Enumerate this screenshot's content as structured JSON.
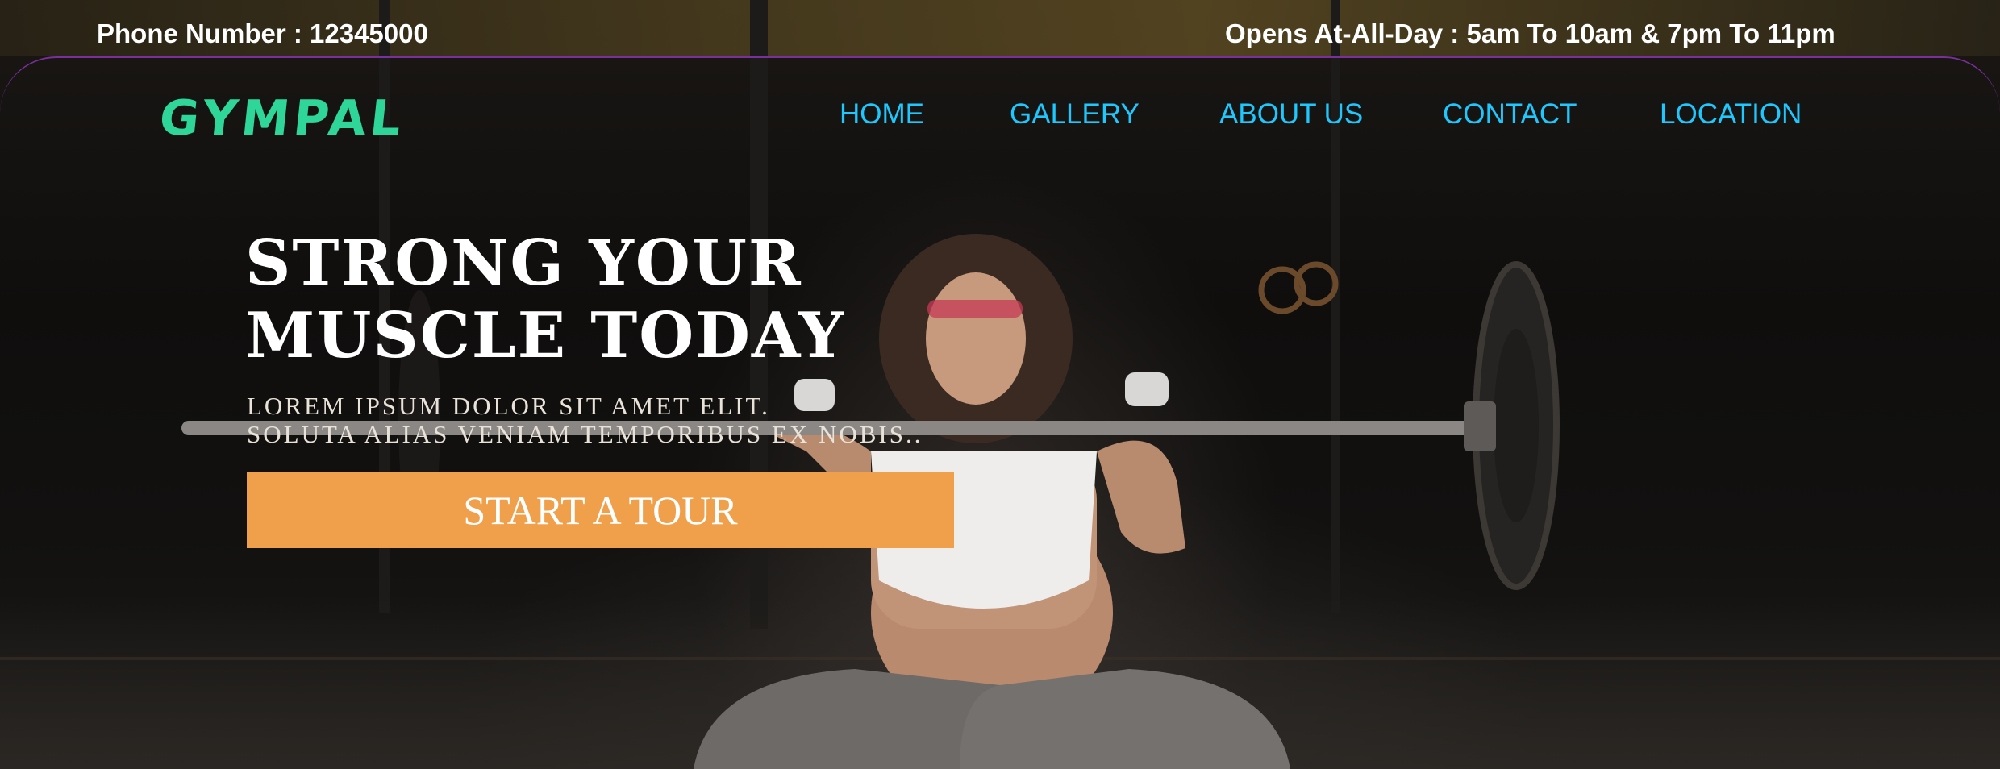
{
  "topbar": {
    "phone": "Phone Number : 12345000",
    "hours": "Opens At-All-Day : 5am To 10am & 7pm To 11pm"
  },
  "brand": {
    "logo": "GYMPAL",
    "logo_color": "#2fd69a"
  },
  "nav": {
    "items": [
      {
        "label": "HOME"
      },
      {
        "label": "GALLERY"
      },
      {
        "label": "ABOUT US"
      },
      {
        "label": "CONTACT"
      },
      {
        "label": "LOCATION"
      }
    ],
    "color": "#1ec8ff"
  },
  "hero": {
    "title_line1": "STRONG YOUR",
    "title_line2": "MUSCLE TODAY",
    "subtitle_line1": "LOREM IPSUM DOLOR SIT AMET ELIT.",
    "subtitle_line2": "SOLUTA ALIAS VENIAM TEMPORIBUS EX NOBIS..",
    "cta_label": "START A TOUR",
    "cta_color": "#f0a04b"
  },
  "background": {
    "image_subject": "woman-lifting-barbell-in-dark-gym"
  }
}
